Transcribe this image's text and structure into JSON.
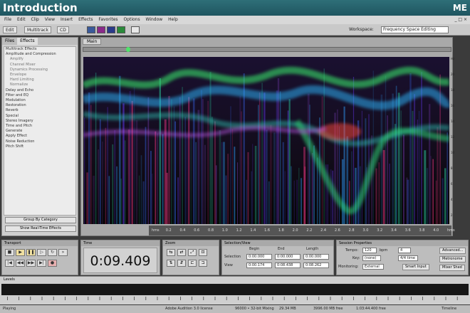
{
  "banner": {
    "title": "Introduction",
    "tag": "ME"
  },
  "menu": [
    "File",
    "Edit",
    "Clip",
    "View",
    "Insert",
    "Effects",
    "Favorites",
    "Options",
    "Window",
    "Help"
  ],
  "toolbar": {
    "edit_label": "Edit",
    "multitrack_label": "Multitrack",
    "cd_label": "CD",
    "workspace_label": "Workspace:",
    "workspace_value": "Frequency Space Editing"
  },
  "left_panel": {
    "tabs": [
      "Files",
      "Effects"
    ],
    "tree": [
      {
        "label": "Multitrack Effects",
        "sub": false
      },
      {
        "label": "Amplitude and Compression",
        "sub": false
      },
      {
        "label": "Amplify",
        "sub": true
      },
      {
        "label": "Channel Mixer",
        "sub": true
      },
      {
        "label": "Dynamics Processing",
        "sub": true
      },
      {
        "label": "Envelope",
        "sub": true
      },
      {
        "label": "Hard Limiting",
        "sub": true
      },
      {
        "label": "Normalize",
        "sub": true
      },
      {
        "label": "Delay and Echo",
        "sub": false
      },
      {
        "label": "Filter and EQ",
        "sub": false
      },
      {
        "label": "Modulation",
        "sub": false
      },
      {
        "label": "Restoration",
        "sub": false
      },
      {
        "label": "Reverb",
        "sub": false
      },
      {
        "label": "Special",
        "sub": false
      },
      {
        "label": "Stereo Imagery",
        "sub": false
      },
      {
        "label": "Time and Pitch",
        "sub": false
      },
      {
        "label": "Generate",
        "sub": false
      },
      {
        "label": "Apply Effect",
        "sub": false
      },
      {
        "label": "Noise Reduction",
        "sub": false
      },
      {
        "label": "Pitch Shift",
        "sub": false
      }
    ],
    "group_button": "Group By Category",
    "show_button": "Show Real-Time Effects"
  },
  "main": {
    "tab": "Main",
    "scale": [
      "Hz",
      "20",
      "18",
      "16",
      "14",
      "12",
      "10",
      "8",
      "6",
      "4",
      "2"
    ],
    "ruler": [
      "hms",
      "0.2",
      "0.4",
      "0.6",
      "0.8",
      "1.0",
      "1.2",
      "1.4",
      "1.6",
      "1.8",
      "2.0",
      "2.2",
      "2.4",
      "2.6",
      "2.8",
      "3.0",
      "3.2",
      "3.4",
      "3.6",
      "3.8",
      "4.0",
      "hms"
    ]
  },
  "transport": {
    "title": "Transport"
  },
  "time": {
    "title": "Time",
    "value": "0:09.409"
  },
  "zoom": {
    "title": "Zoom"
  },
  "selection": {
    "title": "Selection/View",
    "cols": [
      "Begin",
      "End",
      "Length"
    ],
    "rows": [
      {
        "label": "Selection",
        "values": [
          "0:00.000",
          "0:00.000",
          "0:00.000"
        ]
      },
      {
        "label": "View",
        "values": [
          "0:00.174",
          "0:08.438",
          "0:08.262"
        ]
      }
    ]
  },
  "session": {
    "title": "Session Properties",
    "tempo_label": "Tempo:",
    "tempo_value": "120",
    "bpm": "bpm",
    "key_label": "Key:",
    "key_value": "(none)",
    "time_label": "4/4 time",
    "monitoring_label": "Monitoring:",
    "monitoring_value": "External",
    "buttons": [
      "Advanced...",
      "Metronome",
      "Mixer Shed"
    ],
    "advanced_btn": "Advanced...",
    "metronome_btn": "Metronome",
    "mixer_btn": "Mixer Shed",
    "smart_input": "Smart Input"
  },
  "levels": {
    "title": "Levels"
  },
  "status": {
    "left": "Playing",
    "app": "Adobe Audition 3.0 license",
    "format": "96000 • 32-bit Mixing",
    "size": "29.34 MB",
    "free": "3996.00 MB free",
    "time": "1:03:44.400 free",
    "right": "Timeline"
  }
}
